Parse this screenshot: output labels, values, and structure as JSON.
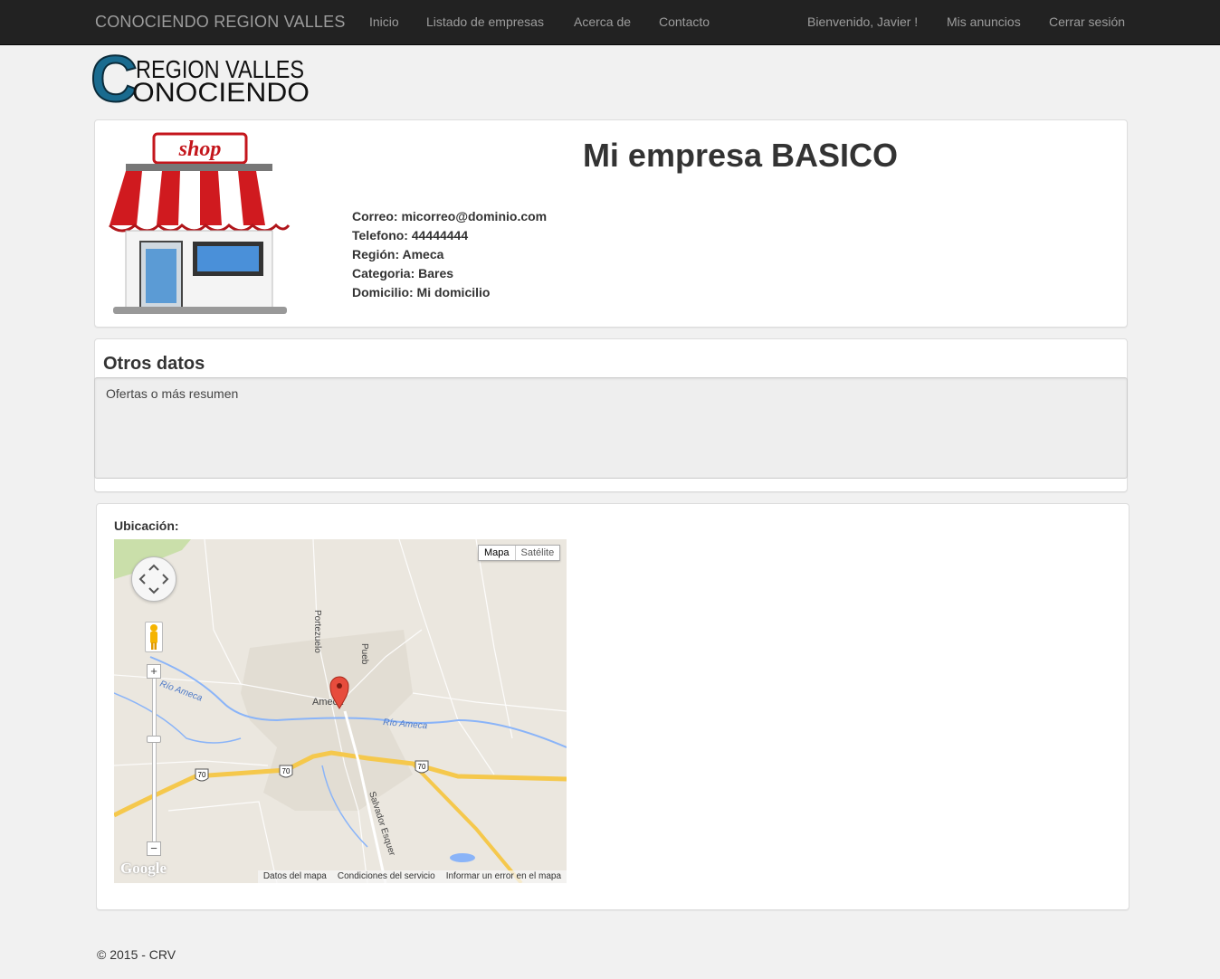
{
  "nav": {
    "brand": "CONOCIENDO REGION VALLES",
    "links": [
      "Inicio",
      "Listado de empresas",
      "Acerca de",
      "Contacto"
    ],
    "welcome": "Bienvenido, Javier !",
    "my_ads": "Mis anuncios",
    "logout": "Cerrar sesión"
  },
  "logo": {
    "line1": "REGION VALLES",
    "line2": "ONOCIENDO",
    "letter": "C"
  },
  "company": {
    "shop_sign": "shop",
    "title": "Mi empresa BASICO",
    "info": [
      "Correo: micorreo@dominio.com",
      "Telefono: 44444444",
      "Región: Ameca",
      "Categoria: Bares",
      "Domicilio: Mi domicilio"
    ]
  },
  "otros": {
    "title": "Otros datos",
    "body": "Ofertas o más resumen"
  },
  "location": {
    "label": "Ubicación:",
    "map": {
      "type_map": "Mapa",
      "type_satellite": "Satélite",
      "zoom_in": "+",
      "zoom_out": "−",
      "google": "Google",
      "attribution": [
        "Datos del mapa",
        "Condiciones del servicio",
        "Informar un error en el mapa"
      ],
      "place_labels": [
        "Ameca",
        "Río Ameca",
        "Río Ameca",
        "Portezuelo",
        "Pueb",
        "Salvador Esquer"
      ],
      "highway_shields": [
        "70",
        "70",
        "70"
      ]
    }
  },
  "footer": "© 2015 - CRV"
}
